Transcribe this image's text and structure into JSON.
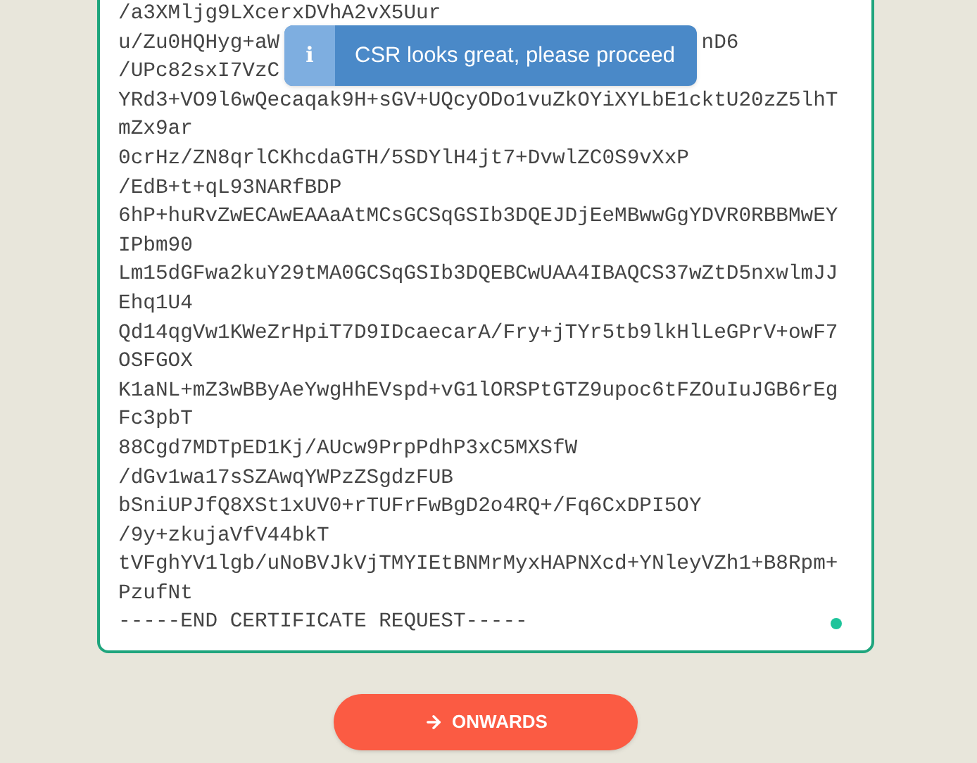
{
  "csr": {
    "lines": [
      {
        "kind": "plain",
        "text": "/a3XMljg9LXcerxDVhA2vX5Uur"
      },
      {
        "kind": "covered",
        "before": "u/Zu0HQHyg+aW",
        "after": "nD6"
      },
      {
        "kind": "covered",
        "before": "/UPc82sxI7VzC"
      },
      {
        "kind": "plain",
        "text": "YRd3+VO9l6wQecaqak9H+sGV+UQcyODo1vuZkOYiXYLbE1cktU20zZ5lhT"
      },
      {
        "kind": "plain",
        "text": "mZx9ar"
      },
      {
        "kind": "plain",
        "text": "0crHz/ZN8qrlCKhcdaGTH/5SDYlH4jt7+DvwlZC0S9vXxP"
      },
      {
        "kind": "plain",
        "text": "/EdB+t+qL93NARfBDP"
      },
      {
        "kind": "plain",
        "text": "6hP+huRvZwECAwEAAaAtMCsGCSqGSIb3DQEJDjEeMBwwGgYDVR0RBBMwEY"
      },
      {
        "kind": "plain",
        "text": "IPbm90"
      },
      {
        "kind": "plain",
        "text": "Lm15dGFwa2kuY29tMA0GCSqGSIb3DQEBCwUAA4IBAQCS37wZtD5nxwlmJJ"
      },
      {
        "kind": "plain",
        "text": "Ehq1U4"
      },
      {
        "kind": "plain",
        "text": "Qd14qgVw1KWeZrHpiT7D9IDcaecarA/Fry+jTYr5tb9lkHlLeGPrV+owF7"
      },
      {
        "kind": "plain",
        "text": "OSFGOX"
      },
      {
        "kind": "plain",
        "text": "K1aNL+mZ3wBByAeYwgHhEVspd+vG1lORSPtGTZ9upoc6tFZOuIuJGB6rEg"
      },
      {
        "kind": "plain",
        "text": "Fc3pbT"
      },
      {
        "kind": "plain",
        "text": "88Cgd7MDTpED1Kj/AUcw9PrpPdhP3xC5MXSfW"
      },
      {
        "kind": "plain",
        "text": "/dGv1wa17sSZAwqYWPzZSgdzFUB"
      },
      {
        "kind": "plain",
        "text": "bSniUPJfQ8XSt1xUV0+rTUFrFwBgD2o4RQ+/Fq6CxDPI5OY"
      },
      {
        "kind": "plain",
        "text": "/9y+zkujaVfV44bkT"
      },
      {
        "kind": "plain",
        "text": "tVFghYV1lgb/uNoBVJkVjTMYIEtBNMrMyxHAPNXcd+YNleyVZh1+B8Rpm+"
      },
      {
        "kind": "plain",
        "text": "PzufNt"
      },
      {
        "kind": "plain",
        "text": "-----END CERTIFICATE REQUEST-----"
      }
    ]
  },
  "toast": {
    "icon": "i",
    "message": "CSR looks great, please proceed"
  },
  "button": {
    "label": "ONWARDS"
  }
}
